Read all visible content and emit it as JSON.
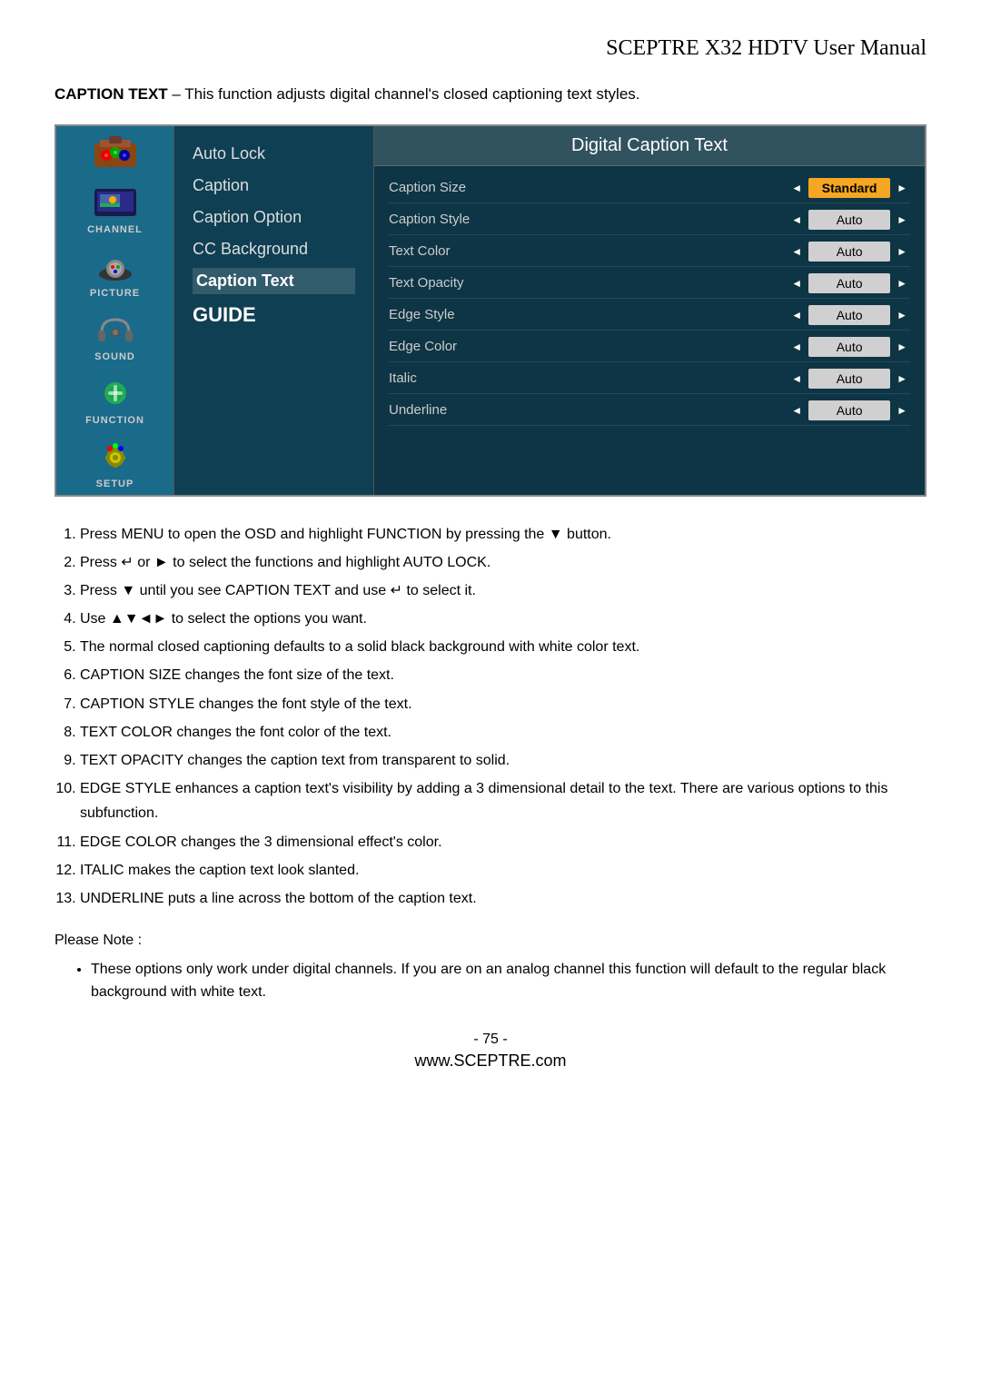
{
  "header": {
    "title": "SCEPTRE X32 HDTV User Manual"
  },
  "intro": {
    "label": "CAPTION TEXT",
    "dash": " – ",
    "text": "This function adjusts digital channel's closed captioning text styles."
  },
  "osd": {
    "panel_title": "Digital Caption Text",
    "sidebar": {
      "items": [
        {
          "id": "toolbox",
          "label": "",
          "active": false
        },
        {
          "id": "channel",
          "label": "CHANNEL",
          "active": false
        },
        {
          "id": "picture",
          "label": "PICTURE",
          "active": false
        },
        {
          "id": "sound",
          "label": "SOUND",
          "active": false
        },
        {
          "id": "function",
          "label": "FUNCTION",
          "active": false
        },
        {
          "id": "setup",
          "label": "SETUP",
          "active": false
        }
      ]
    },
    "menu": {
      "items": [
        {
          "label": "Auto Lock",
          "active": false
        },
        {
          "label": "Caption",
          "active": false
        },
        {
          "label": "Caption Option",
          "active": false
        },
        {
          "label": "CC Background",
          "active": false
        },
        {
          "label": "Caption Text",
          "active": true
        },
        {
          "label": "GUIDE",
          "active": false,
          "style": "guide"
        }
      ]
    },
    "caption_rows": [
      {
        "label": "Caption Size",
        "value": "Standard",
        "highlight": true
      },
      {
        "label": "Caption Style",
        "value": "Auto",
        "highlight": false
      },
      {
        "label": "Text Color",
        "value": "Auto",
        "highlight": false
      },
      {
        "label": "Text Opacity",
        "value": "Auto",
        "highlight": false
      },
      {
        "label": "Edge Style",
        "value": "Auto",
        "highlight": false
      },
      {
        "label": "Edge Color",
        "value": "Auto",
        "highlight": false
      },
      {
        "label": "Italic",
        "value": "Auto",
        "highlight": false
      },
      {
        "label": "Underline",
        "value": "Auto",
        "highlight": false
      }
    ]
  },
  "instructions": {
    "items": [
      "Press MENU to open the OSD and highlight FUNCTION by pressing the ▼ button.",
      "Press ↵ or ► to select the functions and highlight AUTO LOCK.",
      "Press ▼ until you see CAPTION TEXT and use ↵ to select it.",
      "Use ▲▼◄► to select the options you want.",
      "The normal closed captioning defaults to a solid black background with white color text.",
      "CAPTION SIZE changes the font size of the text.",
      "CAPTION STYLE changes the font style of the text.",
      "TEXT COLOR changes the font color of the text.",
      "TEXT OPACITY changes the caption text from transparent to solid.",
      "EDGE STYLE enhances a caption text's visibility by adding a 3 dimensional detail to the text.  There are various options to this subfunction.",
      "EDGE COLOR changes the 3 dimensional effect's color.",
      "ITALIC makes the caption text look slanted.",
      "UNDERLINE puts a line across the bottom of the caption text."
    ]
  },
  "note": {
    "heading": "Please Note :",
    "bullets": [
      "These options only work under digital channels. If you are on an analog channel this function will default to the regular black background with white text."
    ]
  },
  "footer": {
    "page": "- 75 -",
    "website": "www.SCEPTRE.com"
  }
}
